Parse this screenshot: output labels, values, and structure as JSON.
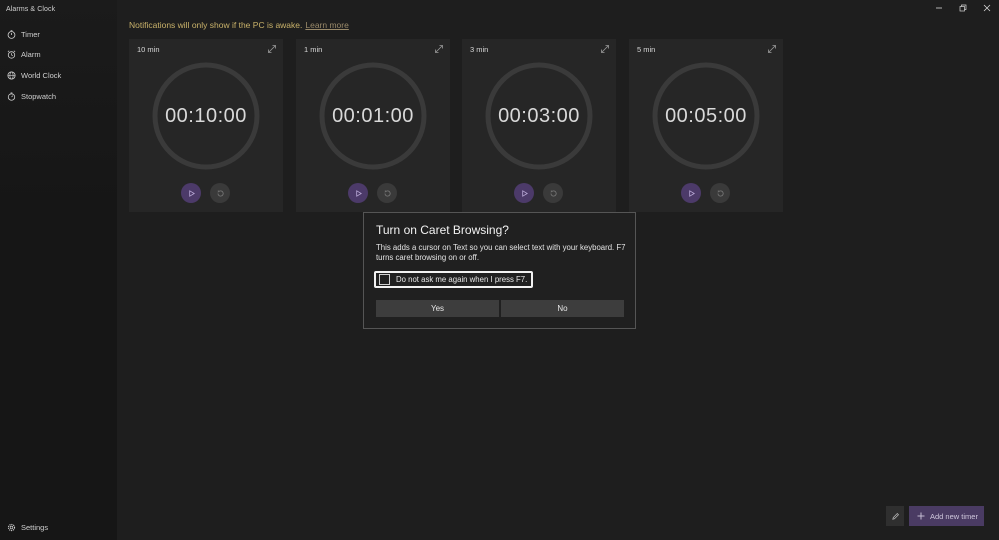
{
  "app": {
    "title": "Alarms & Clock"
  },
  "sidebar": {
    "items": [
      {
        "label": "Timer",
        "icon": "timer-icon"
      },
      {
        "label": "Alarm",
        "icon": "alarm-icon"
      },
      {
        "label": "World Clock",
        "icon": "globe-icon"
      },
      {
        "label": "Stopwatch",
        "icon": "stopwatch-icon"
      }
    ],
    "settings": {
      "label": "Settings",
      "icon": "gear-icon"
    }
  },
  "notification": {
    "text": "Notifications will only show if the PC is awake.",
    "link": "Learn more"
  },
  "timers": [
    {
      "name": "10 min",
      "time": "00:10:00"
    },
    {
      "name": "1 min",
      "time": "00:01:00"
    },
    {
      "name": "3 min",
      "time": "00:03:00"
    },
    {
      "name": "5 min",
      "time": "00:05:00"
    }
  ],
  "dialog": {
    "title": "Turn on Caret Browsing?",
    "body": "This adds a cursor on Text so you can select text with your keyboard. F7 turns caret browsing on or off.",
    "checkbox_label": "Do not ask me again when I press F7.",
    "checkbox_checked": false,
    "yes_label": "Yes",
    "no_label": "No"
  },
  "footer": {
    "add_label": "Add new timer"
  },
  "colors": {
    "accent": "#4c3a69",
    "notification": "#c9b26a",
    "card": "#262626",
    "ring": "#3a3a3a"
  }
}
